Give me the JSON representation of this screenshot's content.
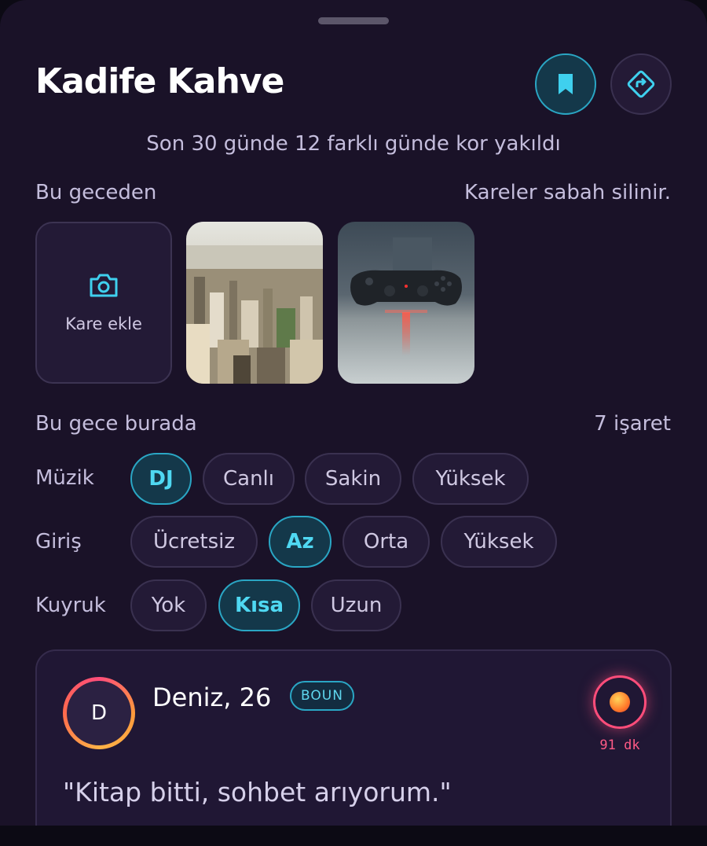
{
  "header": {
    "title": "Kadife Kahve",
    "subtitle": "Son 30 günde 12 farklı günde kor yakıldı",
    "bookmark_icon": "bookmark-icon",
    "directions_icon": "directions-icon"
  },
  "photos_section": {
    "label": "Bu geceden",
    "note": "Kareler sabah silinir.",
    "add_label": "Kare ekle",
    "add_icon": "camera-icon"
  },
  "tonight_section": {
    "label": "Bu gece burada",
    "count": "7 işaret"
  },
  "filters": {
    "music": {
      "label": "Müzik",
      "options": [
        "DJ",
        "Canlı",
        "Sakin",
        "Yüksek"
      ],
      "selected": "DJ"
    },
    "entry": {
      "label": "Giriş",
      "options": [
        "Ücretsiz",
        "Az",
        "Orta",
        "Yüksek"
      ],
      "selected": "Az"
    },
    "queue": {
      "label": "Kuyruk",
      "options": [
        "Yok",
        "Kısa",
        "Uzun"
      ],
      "selected": "Kısa"
    }
  },
  "profile_card": {
    "avatar_initial": "D",
    "name": "Deniz, 26",
    "badge": "BOUN",
    "timer": "91 dk",
    "quote": "\"Kitap bitti, sohbet arıyorum.\""
  },
  "colors": {
    "accent": "#2aa6c4",
    "accent_text": "#4fd8f2",
    "background": "#1a1228",
    "timer": "#ff4d7a"
  }
}
